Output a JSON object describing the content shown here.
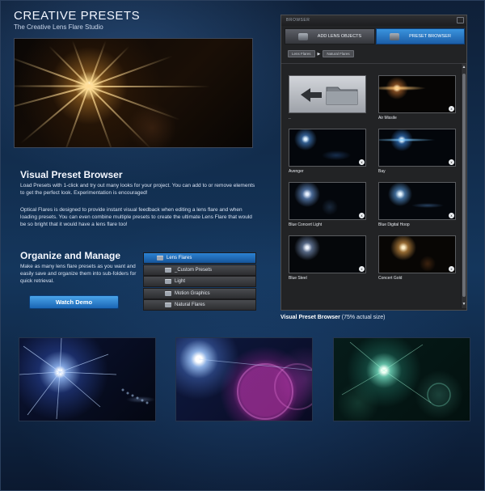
{
  "header": {
    "title": "CREATIVE PRESETS",
    "subtitle": "The Creative Lens Flare Studio"
  },
  "section1": {
    "heading": "Visual Preset Browser",
    "para1": "Load Presets with 1-click and try out many looks for your project. You can add to or remove elements to get the perfect look. Experimentation is encouraged!",
    "para2": "Optical Flares is designed to provide instant visual feedback when editing a lens flare and when loading presets. You can even combine multiple presets to create the ultimate Lens Flare that would be so bright that it would have a lens flare too!"
  },
  "section2": {
    "heading": "Organize and Manage",
    "para": "Make as many lens flare presets as you want and easily save and organize them into sub-folders for quick retrieval.",
    "button": "Watch Demo"
  },
  "folders": [
    {
      "label": "Lens Flares",
      "selected": true
    },
    {
      "label": "_Custom Presets",
      "selected": false
    },
    {
      "label": "Light",
      "selected": false
    },
    {
      "label": "Motion Graphics",
      "selected": false
    },
    {
      "label": "Natural Flares",
      "selected": false
    }
  ],
  "browser": {
    "title": "BROWSER",
    "tab_add": "ADD LENS OBJECTS",
    "tab_preset": "PRESET BROWSER",
    "crumbs": [
      "Lens Flares",
      "Natural Flares"
    ],
    "items": [
      {
        "label": "..",
        "kind": "back",
        "x": false
      },
      {
        "label": "Air Missile",
        "kind": "orange",
        "x": true
      },
      {
        "label": "Avenger",
        "kind": "blue",
        "x": true
      },
      {
        "label": "Bay",
        "kind": "blue",
        "x": true
      },
      {
        "label": "Blue Concert Light",
        "kind": "blue",
        "x": true
      },
      {
        "label": "Blue Digital Hoop",
        "kind": "blue",
        "x": true
      },
      {
        "label": "Blue Steel",
        "kind": "blue",
        "x": true
      },
      {
        "label": "Concert Gold",
        "kind": "gold",
        "x": true
      }
    ],
    "delete_badge": "x"
  },
  "caption": {
    "bold": "Visual Preset Browser",
    "rest": " (75% actual size)"
  },
  "colors": {
    "accent_blue": "#2c82d2",
    "button_blue": "#1a66b4",
    "panel_bg": "#222325"
  }
}
